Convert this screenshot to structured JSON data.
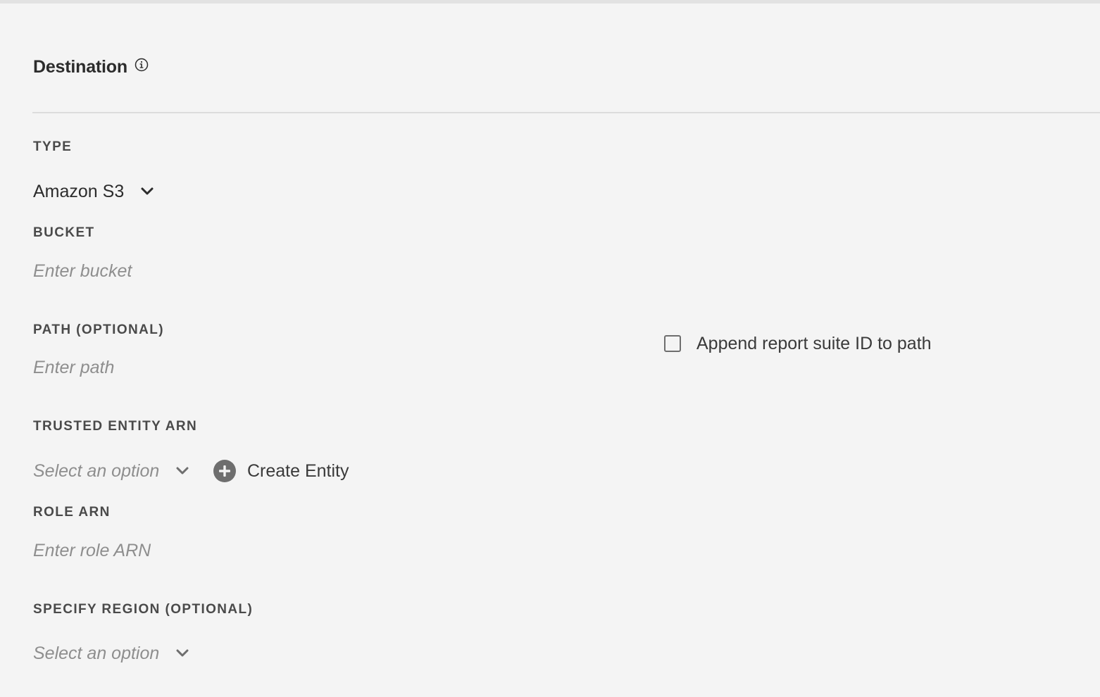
{
  "section": {
    "title": "Destination",
    "info_icon": "info-circle-icon"
  },
  "type": {
    "label": "TYPE",
    "selected": "Amazon S3",
    "chevron_icon": "chevron-down-icon"
  },
  "bucket": {
    "label": "BUCKET",
    "value": "",
    "placeholder": "Enter bucket"
  },
  "path": {
    "label": "PATH (OPTIONAL)",
    "value": "",
    "placeholder": "Enter path"
  },
  "append_checkbox": {
    "label": "Append report suite ID to path",
    "checked": false
  },
  "trusted_entity": {
    "label": "TRUSTED ENTITY ARN",
    "placeholder": "Select an option",
    "chevron_icon": "chevron-down-icon",
    "create_button": {
      "label": "Create Entity",
      "icon": "plus-circle-icon"
    }
  },
  "role_arn": {
    "label": "ROLE ARN",
    "value": "",
    "placeholder": "Enter role ARN"
  },
  "region": {
    "label": "SPECIFY REGION (OPTIONAL)",
    "placeholder": "Select an option",
    "chevron_icon": "chevron-down-icon"
  },
  "colors": {
    "background": "#f4f4f4",
    "text": "#2c2c2c",
    "label": "#4a4a4a",
    "placeholder": "#8e8e8e",
    "icon": "#6e6e6e",
    "divider": "#dcdcdc"
  }
}
